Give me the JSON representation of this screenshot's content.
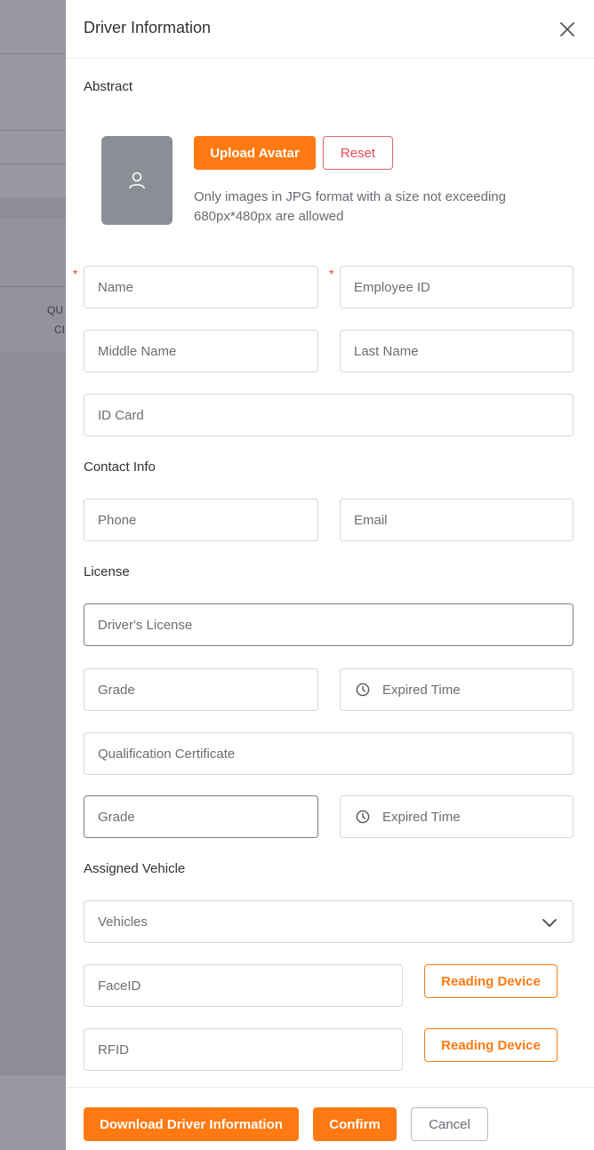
{
  "background": {
    "col_text_1": "QU",
    "col_text_2": "CI"
  },
  "drawer": {
    "title": "Driver Information",
    "close_icon": "close-icon"
  },
  "abstract": {
    "title": "Abstract",
    "avatar_icon": "user-icon",
    "upload_label": "Upload Avatar",
    "reset_label": "Reset",
    "hint": "Only images in JPG format with a size not exceeding 680px*480px are allowed"
  },
  "basic": {
    "name_placeholder": "Name",
    "employee_id_placeholder": "Employee ID",
    "middle_name_placeholder": "Middle Name",
    "last_name_placeholder": "Last Name",
    "id_card_placeholder": "ID Card",
    "required_mark": "*"
  },
  "contact": {
    "title": "Contact Info",
    "phone_placeholder": "Phone",
    "email_placeholder": "Email"
  },
  "license": {
    "title": "License",
    "drivers_license_placeholder": "Driver's License",
    "grade_placeholder": "Grade",
    "expired_time_placeholder": "Expired Time",
    "qualification_placeholder": "Qualification Certificate",
    "grade2_placeholder": "Grade",
    "expired_time2_placeholder": "Expired Time"
  },
  "vehicle": {
    "title": "Assigned Vehicle",
    "vehicles_placeholder": "Vehicles",
    "faceid_placeholder": "FaceID",
    "rfid_placeholder": "RFID",
    "reading_device_label": "Reading Device"
  },
  "footer": {
    "download_label": "Download Driver Information",
    "confirm_label": "Confirm",
    "cancel_label": "Cancel"
  },
  "colors": {
    "accent": "#ff7a12",
    "danger": "#e04c55"
  }
}
